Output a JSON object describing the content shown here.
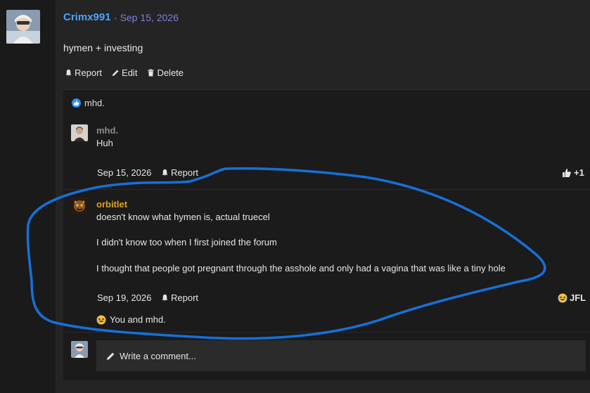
{
  "post": {
    "author": "Crimx991",
    "separator": "·",
    "date": "Sep 15, 2026",
    "body": "hymen + investing",
    "actions": {
      "report": "Report",
      "edit": "Edit",
      "delete": "Delete"
    }
  },
  "reactions_summary": {
    "text": "mhd."
  },
  "comments": [
    {
      "author": "mhd.",
      "lines": [
        "Huh"
      ],
      "date": "Sep 15, 2026",
      "report": "Report",
      "reaction_count": "+1"
    },
    {
      "author": "orbitlet",
      "lines": [
        "doesn't know what hymen is, actual truecel",
        "I didn't know too when I first joined the forum",
        "I thought that people got pregnant through the asshole and only had a vagina that was like a tiny hole"
      ],
      "date": "Sep 19, 2026",
      "report": "Report",
      "reaction_label": "JFL",
      "reactors": "You and mhd."
    }
  ],
  "write_comment": {
    "label": "Write a comment..."
  },
  "colors": {
    "author_link": "#4aa3ff",
    "date": "#7f7fe0",
    "gold_user": "#e3a21a",
    "annotation": "#1670d8"
  }
}
